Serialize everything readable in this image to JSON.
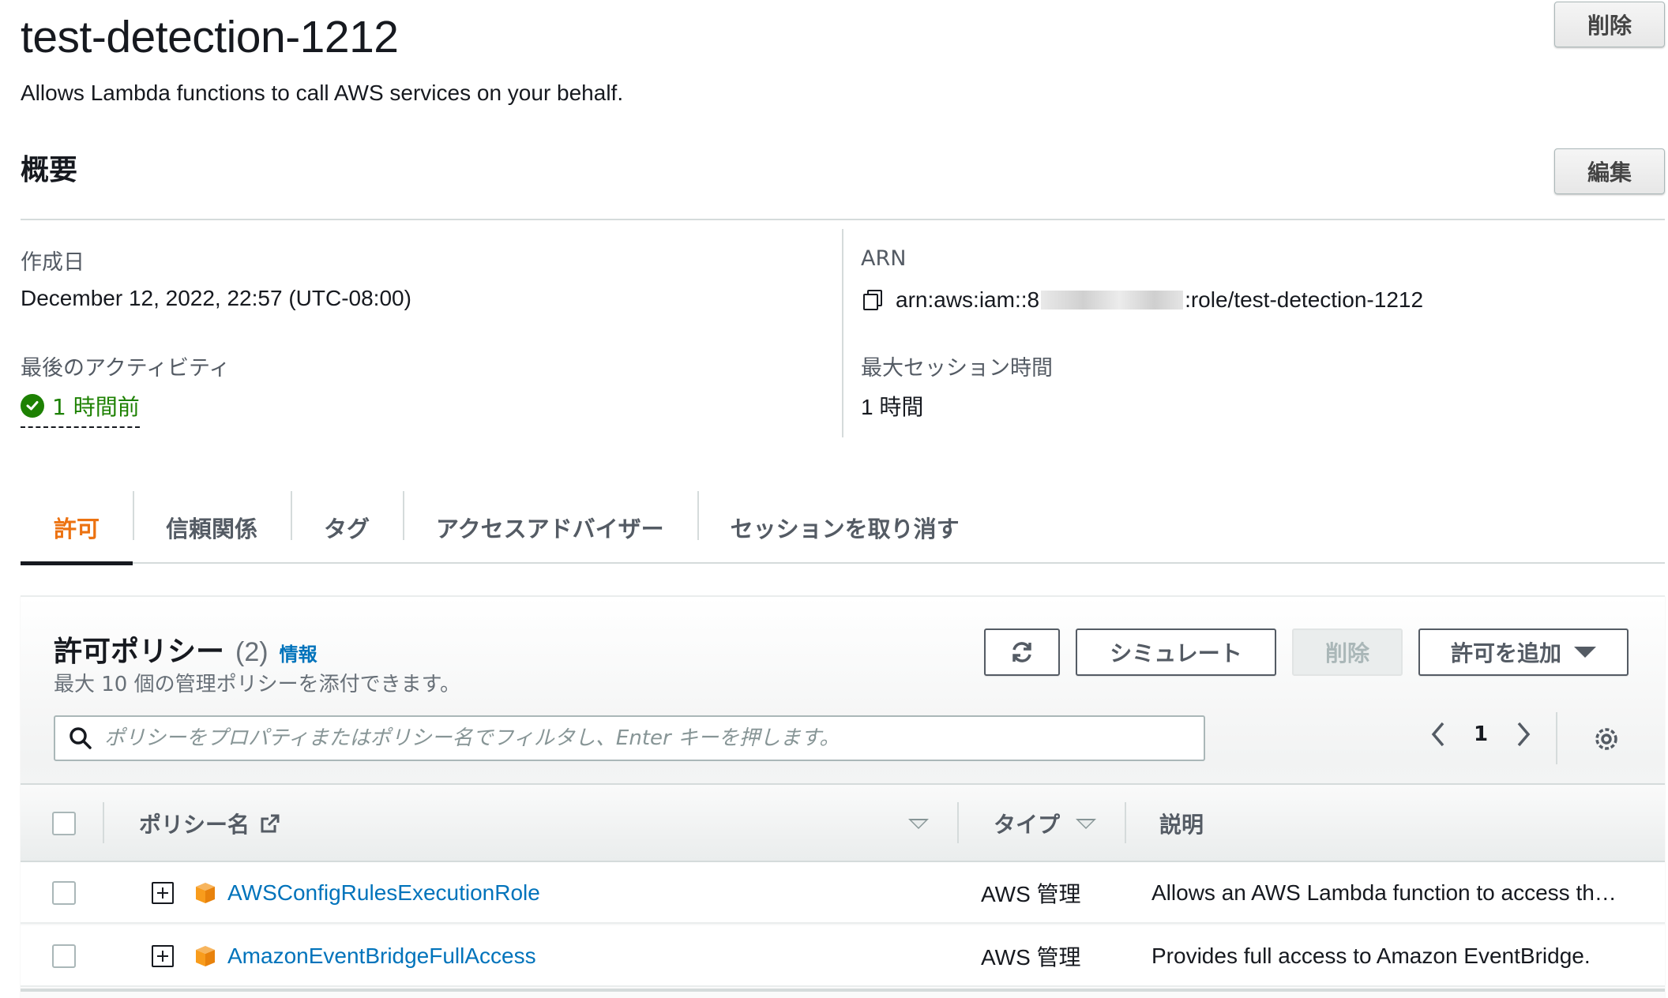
{
  "role": {
    "name": "test-detection-1212",
    "description": "Allows Lambda functions to call AWS services on your behalf.",
    "delete_label": "削除"
  },
  "summary": {
    "heading": "概要",
    "edit_label": "編集",
    "created_label": "作成日",
    "created_value": "December 12, 2022, 22:57 (UTC-08:00)",
    "last_activity_label": "最後のアクティビティ",
    "last_activity_value": "1 時間前",
    "arn_label": "ARN",
    "arn_prefix": "arn:aws:iam::8",
    "arn_suffix": ":role/test-detection-1212",
    "max_session_label": "最大セッション時間",
    "max_session_value": "1 時間"
  },
  "tabs": [
    {
      "label": "許可",
      "active": true
    },
    {
      "label": "信頼関係",
      "active": false
    },
    {
      "label": "タグ",
      "active": false
    },
    {
      "label": "アクセスアドバイザー",
      "active": false
    },
    {
      "label": "セッションを取り消す",
      "active": false
    }
  ],
  "permissions": {
    "title": "許可ポリシー",
    "count": "(2)",
    "info_label": "情報",
    "subtitle": "最大 10 個の管理ポリシーを添付できます。",
    "simulate_label": "シミュレート",
    "delete_label": "削除",
    "add_label": "許可を追加",
    "search_placeholder": "ポリシーをプロパティまたはポリシー名でフィルタし、Enter キーを押します。",
    "page": "1",
    "columns": {
      "name": "ポリシー名",
      "type": "タイプ",
      "description": "説明"
    },
    "rows": [
      {
        "name": "AWSConfigRulesExecutionRole",
        "type": "AWS 管理",
        "description": "Allows an AWS Lambda function to access th…"
      },
      {
        "name": "AmazonEventBridgeFullAccess",
        "type": "AWS 管理",
        "description": "Provides full access to Amazon EventBridge."
      }
    ]
  },
  "colors": {
    "accent": "#ec7211",
    "link": "#0073bb",
    "success": "#1d8102",
    "policy_icon": "#f89c1c"
  },
  "icons": [
    "copy-icon",
    "check-circle-icon",
    "refresh-icon",
    "caret-down-icon",
    "search-icon",
    "chevron-left-icon",
    "chevron-right-icon",
    "settings-gear-icon",
    "external-link-icon",
    "sort-down-icon",
    "expand-plus-icon",
    "policy-box-icon"
  ]
}
